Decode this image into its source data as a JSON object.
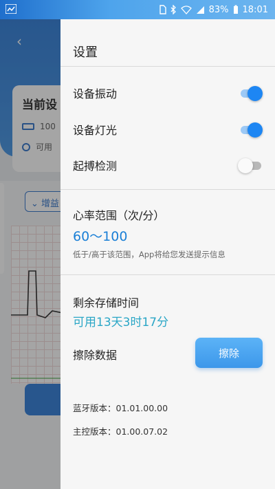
{
  "status_bar": {
    "battery_percent": "83%",
    "time": "18:01",
    "icons": [
      "notification-icon",
      "sim-icon",
      "bluetooth-icon",
      "wifi-icon",
      "signal-icon",
      "battery-icon"
    ]
  },
  "background_app": {
    "card_title": "当前设",
    "battery_text": "100",
    "status_text": "可用",
    "selector_label": "增益"
  },
  "drawer": {
    "title": "设置",
    "toggles": [
      {
        "label": "设备振动",
        "on": true
      },
      {
        "label": "设备灯光",
        "on": true
      },
      {
        "label": "起搏检测",
        "on": false
      }
    ],
    "heart_rate": {
      "title": "心率范围（次/分）",
      "value": "60～100",
      "hint": "低于/高于该范围，App将给您发送提示信息"
    },
    "storage": {
      "title": "剩余存储时间",
      "value": "可用13天3时17分"
    },
    "erase": {
      "label": "擦除数据",
      "button": "擦除"
    },
    "versions": {
      "bluetooth": "蓝牙版本：01.01.00.00",
      "main": "主控版本：01.00.07.02"
    }
  },
  "colors": {
    "accent": "#1d86f3",
    "range_value": "#1a7fd6",
    "storage_value": "#2aa6c6"
  }
}
